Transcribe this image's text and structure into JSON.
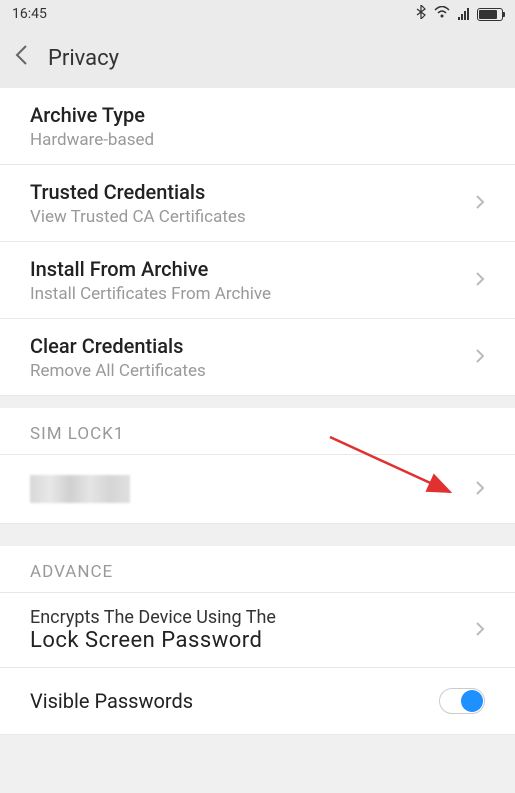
{
  "status": {
    "time": "16:45"
  },
  "header": {
    "title": "Privacy"
  },
  "items": {
    "archive_type": {
      "title": "Archive Type",
      "subtitle": "Hardware-based"
    },
    "trusted": {
      "title": "Trusted Credentials",
      "subtitle": "View Trusted CA Certificates"
    },
    "install": {
      "title": "Install From Archive",
      "subtitle": "Install Certificates From Archive"
    },
    "clear": {
      "title": "Clear Credentials",
      "subtitle": "Remove All Certificates"
    }
  },
  "sections": {
    "sim_lock": "SIM LOCK1",
    "advance": "ADVANCE"
  },
  "encrypt": {
    "line1": "Encrypts The Device Using The",
    "line2": "Lock Screen Password"
  },
  "visible_passwords": {
    "title": "Visible Passwords"
  }
}
